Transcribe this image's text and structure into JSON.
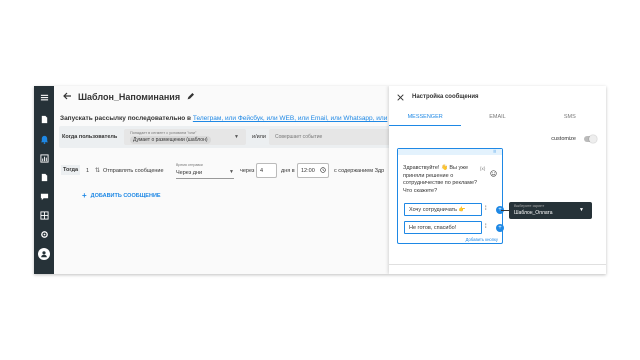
{
  "header": {
    "title": "Шаблон_Напоминания"
  },
  "intro": {
    "prefix": "Запускать рассылку последовательно в",
    "channels": "Телеграм, или Фейсбук, или WEB, или Email, или Whatsapp, или"
  },
  "when_row": {
    "label": "Когда пользователь",
    "segment_caption": "Попадает в сегмент с условием \"или\"",
    "segment_value": "Думает о размещении (шаблон)",
    "or_label": "и/или",
    "event_placeholder": "Совершает событие"
  },
  "then_row": {
    "label": "Тогда",
    "index": "1",
    "action_label": "Отправлять сообщение",
    "timing_caption": "Время отправки",
    "timing_value": "Через дни",
    "after_label": "через",
    "days_value": "4",
    "days_suffix": "дня в",
    "time_value": "12:00",
    "content_label": "с содержанием  Здр"
  },
  "add_message": {
    "label": "ДОБАВИТЬ СООБЩЕНИЕ"
  },
  "panel": {
    "title": "Настройка сообщения",
    "tabs": [
      "MESSENGER",
      "EMAIL",
      "SMS"
    ],
    "customize_label": "customize",
    "message_text": "Здравствуйте! 👋 Вы уже приняли решение о сотрудничестве по рекламе? Что скажете?",
    "variable_tag": "{x}",
    "quick_replies": [
      "Хочу сотрудничать 👉",
      "Не готов, спасибо!"
    ],
    "add_button_label": "Добавить кнопку",
    "script_caption": "Выберите скрипт",
    "script_value": "Шаблон_Оплата"
  }
}
